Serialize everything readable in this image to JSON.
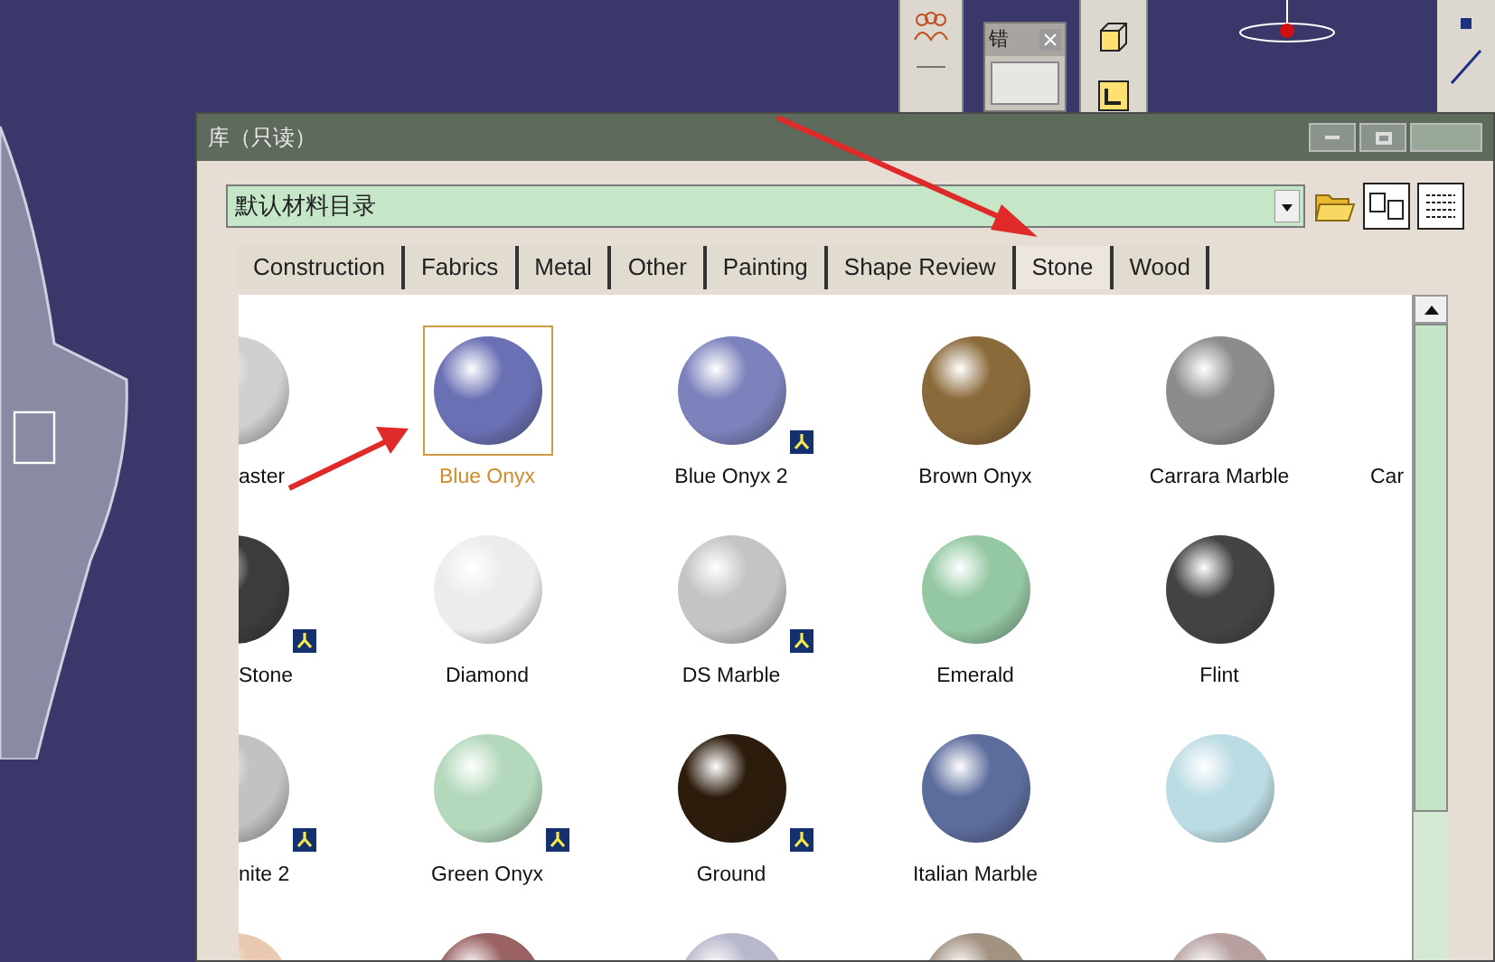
{
  "toolbars": {
    "floating_title": "错"
  },
  "dialog": {
    "title": "库（只读）",
    "catalog": {
      "value": "默认材料目录"
    },
    "tabs": [
      {
        "label": "Construction",
        "selected": false
      },
      {
        "label": "Fabrics",
        "selected": false
      },
      {
        "label": "Metal",
        "selected": false
      },
      {
        "label": "Other",
        "selected": false
      },
      {
        "label": "Painting",
        "selected": false
      },
      {
        "label": "Shape Review",
        "selected": false
      },
      {
        "label": "Stone",
        "selected": true
      },
      {
        "label": "Wood",
        "selected": false
      }
    ],
    "materials": [
      [
        {
          "kind": "cut-left",
          "label": "aster",
          "color": "#cfcfcf",
          "badge": false,
          "selected": false
        },
        {
          "kind": "full",
          "label": "Blue Onyx",
          "color": "#6a70b4",
          "badge": false,
          "selected": true
        },
        {
          "kind": "full",
          "label": "Blue Onyx 2",
          "color": "#7c82bc",
          "badge": true,
          "selected": false
        },
        {
          "kind": "full",
          "label": "Brown Onyx",
          "color": "#8a6a3a",
          "badge": false,
          "selected": false
        },
        {
          "kind": "full",
          "label": "Carrara Marble",
          "color": "#8c8c8c",
          "badge": false,
          "selected": false
        },
        {
          "kind": "cut-right",
          "label": "Car"
        }
      ],
      [
        {
          "kind": "cut-left",
          "label": "Stone",
          "color": "#3c3c3c",
          "badge": true,
          "selected": false
        },
        {
          "kind": "full",
          "label": "Diamond",
          "color": "#ececec",
          "badge": false,
          "selected": false
        },
        {
          "kind": "full",
          "label": "DS Marble",
          "color": "#c4c4c4",
          "badge": true,
          "selected": false
        },
        {
          "kind": "full",
          "label": "Emerald",
          "color": "#94c8a2",
          "badge": false,
          "selected": false
        },
        {
          "kind": "full",
          "label": "Flint",
          "color": "#444444",
          "badge": false,
          "selected": false
        }
      ],
      [
        {
          "kind": "cut-left",
          "label": "nite 2",
          "color": "#c2c2c2",
          "badge": true,
          "selected": false
        },
        {
          "kind": "full",
          "label": "Green Onyx",
          "color": "#b4d8bc",
          "badge": true,
          "selected": false
        },
        {
          "kind": "full",
          "label": "Ground",
          "color": "#2c1c0c",
          "badge": true,
          "selected": false
        },
        {
          "kind": "full",
          "label": "Italian Marble",
          "color": "#5c6c9c",
          "badge": false,
          "selected": false
        },
        {
          "kind": "full",
          "color": "#bcdce4",
          "badge": false,
          "selected": false
        }
      ],
      [
        {
          "kind": "cut-left",
          "color": "#e8c8b0",
          "badge": false,
          "selected": false
        },
        {
          "kind": "full",
          "color": "#9a6262",
          "badge": false,
          "selected": false
        },
        {
          "kind": "full",
          "color": "#b8b8cc",
          "badge": false,
          "selected": false
        },
        {
          "kind": "full",
          "color": "#a29282",
          "badge": false,
          "selected": false
        },
        {
          "kind": "full",
          "color": "#b8a0a0",
          "badge": false,
          "selected": false
        }
      ]
    ]
  }
}
